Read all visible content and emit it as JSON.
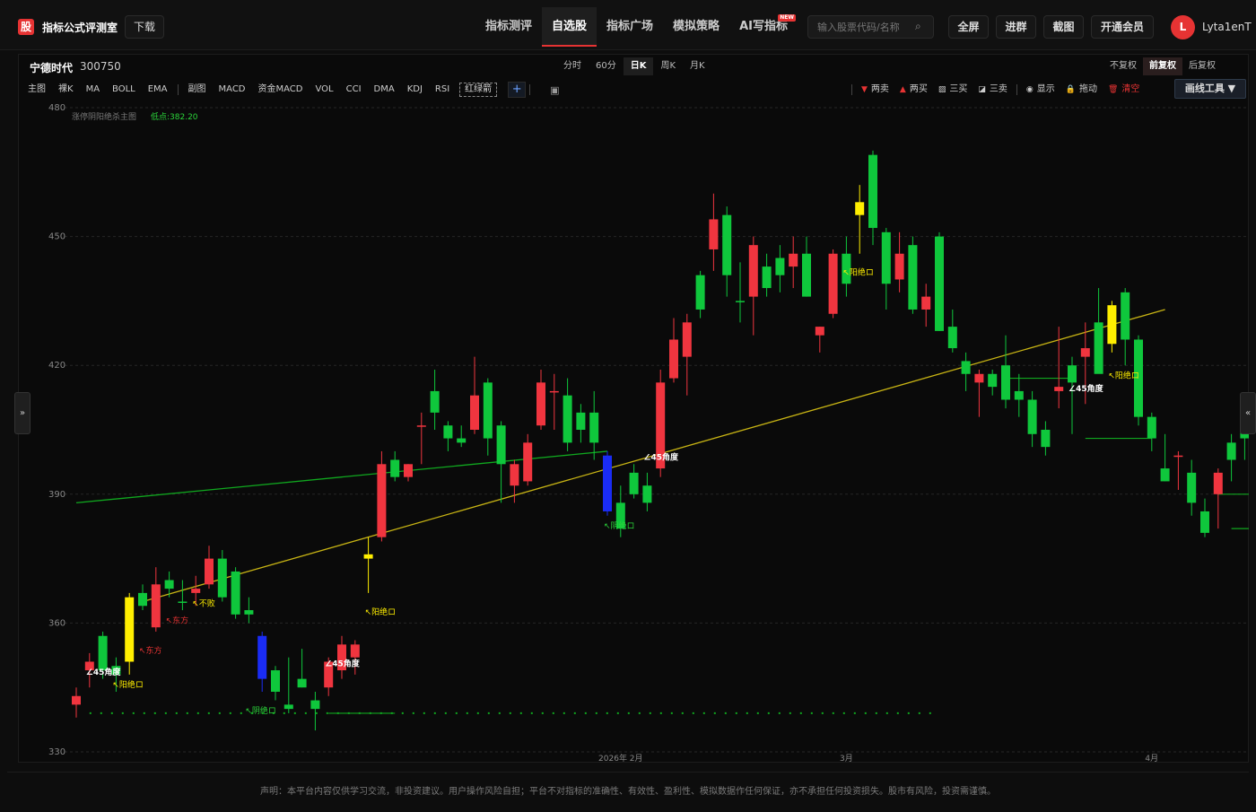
{
  "header": {
    "logo_glyph": "股",
    "logo_text": "指标公式评测室",
    "download_label": "下载",
    "nav": [
      {
        "label": "指标测评",
        "active": false
      },
      {
        "label": "自选股",
        "active": true
      },
      {
        "label": "指标广场",
        "active": false
      },
      {
        "label": "模拟策略",
        "active": false
      },
      {
        "label": "AI写指标",
        "active": false,
        "badge": "NEW"
      }
    ],
    "search_placeholder": "输入股票代码/名称",
    "buttons": [
      "全屏",
      "进群",
      "截图",
      "开通会员"
    ],
    "avatar_letter": "L",
    "username": "Lyta1enT"
  },
  "stock": {
    "name": "宁德时代",
    "code": "300750"
  },
  "periods": [
    {
      "label": "分时",
      "active": false
    },
    {
      "label": "60分",
      "active": false
    },
    {
      "label": "日K",
      "active": true
    },
    {
      "label": "周K",
      "active": false
    },
    {
      "label": "月K",
      "active": false
    }
  ],
  "adjust": [
    {
      "label": "不复权",
      "active": false
    },
    {
      "label": "前复权",
      "active": true
    },
    {
      "label": "后复权",
      "active": false
    }
  ],
  "main_indicators": [
    "主图",
    "裸K",
    "MA",
    "BOLL",
    "EMA"
  ],
  "sub_indicators": [
    "副图",
    "MACD",
    "资金MACD",
    "VOL",
    "CCI",
    "DMA",
    "KDJ",
    "RSI"
  ],
  "boxed_indicator": "红绿箭",
  "plus_label": "+",
  "draw_tools": [
    {
      "icon": "▼",
      "label": "两卖",
      "color": "#e63333"
    },
    {
      "icon": "▲",
      "label": "两买",
      "color": "#e63333"
    },
    {
      "icon": "▨",
      "label": "三买",
      "color": "#ccc"
    },
    {
      "icon": "◪",
      "label": "三卖",
      "color": "#ccc"
    },
    {
      "icon": "◉",
      "label": "显示",
      "color": "#ccc"
    },
    {
      "icon": "🔒",
      "label": "拖动",
      "color": "#ccc"
    },
    {
      "icon": "🗑",
      "label": "清空",
      "color": "#e63333"
    }
  ],
  "draw_tool_button": "画线工具 ▼",
  "side_left": "»",
  "side_right": "«",
  "legend": {
    "name": "涨停阴阳绝杀主图",
    "low": "低点:382.20"
  },
  "footer": "声明：本平台内容仅供学习交流，非投资建议。用户操作风险自担；平台不对指标的准确性、有效性、盈利性、模拟数据作任何保证，亦不承担任何投资损失。股市有风险，投资需谨慎。",
  "chart_data": {
    "type": "candlestick",
    "ylim": [
      330,
      480
    ],
    "y_ticks": [
      330,
      360,
      390,
      420,
      450,
      480
    ],
    "x_labels": [
      {
        "index": 41,
        "label": "2026年 2月"
      },
      {
        "index": 58,
        "label": "3月"
      },
      {
        "index": 81,
        "label": "4月"
      }
    ],
    "colors": {
      "up": "#f0353f",
      "down": "#0fc73c",
      "yellow": "#ffee00",
      "blue": "#1a2cf5"
    },
    "candles": [
      {
        "o": 341,
        "h": 345,
        "l": 338,
        "c": 343,
        "k": "up"
      },
      {
        "o": 349,
        "h": 353,
        "l": 345,
        "c": 351,
        "k": "up"
      },
      {
        "o": 357,
        "h": 358,
        "l": 347,
        "c": 349,
        "k": "down"
      },
      {
        "o": 350,
        "h": 352,
        "l": 344,
        "c": 348,
        "k": "down"
      },
      {
        "o": 351,
        "h": 367,
        "l": 348,
        "c": 366,
        "k": "yellow"
      },
      {
        "o": 367,
        "h": 369,
        "l": 363,
        "c": 364,
        "k": "down"
      },
      {
        "o": 359,
        "h": 373,
        "l": 358,
        "c": 369,
        "k": "up"
      },
      {
        "o": 370,
        "h": 372,
        "l": 366,
        "c": 368,
        "k": "down"
      },
      {
        "o": 365,
        "h": 370,
        "l": 363,
        "c": 365,
        "k": "down"
      },
      {
        "o": 367,
        "h": 371,
        "l": 364,
        "c": 368,
        "k": "up"
      },
      {
        "o": 369,
        "h": 378,
        "l": 368,
        "c": 375,
        "k": "up"
      },
      {
        "o": 375,
        "h": 377,
        "l": 365,
        "c": 366,
        "k": "down"
      },
      {
        "o": 372,
        "h": 373,
        "l": 361,
        "c": 362,
        "k": "down"
      },
      {
        "o": 363,
        "h": 366,
        "l": 360,
        "c": 362,
        "k": "down"
      },
      {
        "o": 357,
        "h": 358,
        "l": 344,
        "c": 347,
        "k": "blue"
      },
      {
        "o": 349,
        "h": 350,
        "l": 342,
        "c": 344,
        "k": "down"
      },
      {
        "o": 341,
        "h": 352,
        "l": 339,
        "c": 340,
        "k": "down"
      },
      {
        "o": 347,
        "h": 354,
        "l": 345,
        "c": 345,
        "k": "down"
      },
      {
        "o": 342,
        "h": 344,
        "l": 335,
        "c": 340,
        "k": "down"
      },
      {
        "o": 345,
        "h": 352,
        "l": 343,
        "c": 351,
        "k": "up"
      },
      {
        "o": 349,
        "h": 357,
        "l": 347,
        "c": 355,
        "k": "up"
      },
      {
        "o": 355,
        "h": 356,
        "l": 348,
        "c": 352,
        "k": "up"
      },
      {
        "o": 376,
        "h": 380,
        "l": 367,
        "c": 375,
        "k": "yellow"
      },
      {
        "o": 380,
        "h": 400,
        "l": 379,
        "c": 397,
        "k": "up"
      },
      {
        "o": 398,
        "h": 400,
        "l": 393,
        "c": 394,
        "k": "down"
      },
      {
        "o": 394,
        "h": 397,
        "l": 393,
        "c": 397,
        "k": "up"
      },
      {
        "o": 406,
        "h": 409,
        "l": 397,
        "c": 406,
        "k": "up"
      },
      {
        "o": 409,
        "h": 419,
        "l": 405,
        "c": 414,
        "k": "down"
      },
      {
        "o": 406,
        "h": 407,
        "l": 400,
        "c": 403,
        "k": "down"
      },
      {
        "o": 403,
        "h": 406,
        "l": 401,
        "c": 402,
        "k": "down"
      },
      {
        "o": 405,
        "h": 422,
        "l": 404,
        "c": 413,
        "k": "up"
      },
      {
        "o": 416,
        "h": 417,
        "l": 399,
        "c": 403,
        "k": "down"
      },
      {
        "o": 406,
        "h": 407,
        "l": 388,
        "c": 397,
        "k": "down"
      },
      {
        "o": 392,
        "h": 398,
        "l": 388,
        "c": 397,
        "k": "up"
      },
      {
        "o": 393,
        "h": 404,
        "l": 392,
        "c": 402,
        "k": "up"
      },
      {
        "o": 406,
        "h": 419,
        "l": 405,
        "c": 416,
        "k": "up"
      },
      {
        "o": 414,
        "h": 418,
        "l": 405,
        "c": 414,
        "k": "up"
      },
      {
        "o": 413,
        "h": 417,
        "l": 400,
        "c": 402,
        "k": "down"
      },
      {
        "o": 409,
        "h": 411,
        "l": 402,
        "c": 405,
        "k": "down"
      },
      {
        "o": 409,
        "h": 414,
        "l": 398,
        "c": 402,
        "k": "down"
      },
      {
        "o": 399,
        "h": 400,
        "l": 385,
        "c": 386,
        "k": "blue"
      },
      {
        "o": 388,
        "h": 392,
        "l": 380,
        "c": 382,
        "k": "down"
      },
      {
        "o": 395,
        "h": 397,
        "l": 389,
        "c": 390,
        "k": "down"
      },
      {
        "o": 392,
        "h": 395,
        "l": 386,
        "c": 388,
        "k": "down"
      },
      {
        "o": 396,
        "h": 419,
        "l": 394,
        "c": 416,
        "k": "up"
      },
      {
        "o": 417,
        "h": 431,
        "l": 416,
        "c": 426,
        "k": "up"
      },
      {
        "o": 422,
        "h": 432,
        "l": 413,
        "c": 430,
        "k": "up"
      },
      {
        "o": 441,
        "h": 442,
        "l": 431,
        "c": 433,
        "k": "down"
      },
      {
        "o": 447,
        "h": 460,
        "l": 442,
        "c": 454,
        "k": "up"
      },
      {
        "o": 455,
        "h": 457,
        "l": 436,
        "c": 441,
        "k": "down"
      },
      {
        "o": 435,
        "h": 444,
        "l": 430,
        "c": 435,
        "k": "down"
      },
      {
        "o": 436,
        "h": 450,
        "l": 427,
        "c": 448,
        "k": "up"
      },
      {
        "o": 443,
        "h": 446,
        "l": 436,
        "c": 438,
        "k": "down"
      },
      {
        "o": 445,
        "h": 448,
        "l": 437,
        "c": 441,
        "k": "down"
      },
      {
        "o": 443,
        "h": 450,
        "l": 438,
        "c": 446,
        "k": "up"
      },
      {
        "o": 446,
        "h": 450,
        "l": 436,
        "c": 436,
        "k": "down"
      },
      {
        "o": 427,
        "h": 429,
        "l": 423,
        "c": 429,
        "k": "up"
      },
      {
        "o": 432,
        "h": 447,
        "l": 431,
        "c": 446,
        "k": "up"
      },
      {
        "o": 446,
        "h": 450,
        "l": 436,
        "c": 439,
        "k": "down"
      },
      {
        "o": 455,
        "h": 462,
        "l": 446,
        "c": 458,
        "k": "yellow"
      },
      {
        "o": 469,
        "h": 470,
        "l": 448,
        "c": 452,
        "k": "down"
      },
      {
        "o": 451,
        "h": 452,
        "l": 433,
        "c": 439,
        "k": "down"
      },
      {
        "o": 440,
        "h": 451,
        "l": 437,
        "c": 446,
        "k": "up"
      },
      {
        "o": 448,
        "h": 450,
        "l": 432,
        "c": 433,
        "k": "down"
      },
      {
        "o": 433,
        "h": 439,
        "l": 429,
        "c": 436,
        "k": "up"
      },
      {
        "o": 450,
        "h": 451,
        "l": 428,
        "c": 428,
        "k": "down"
      },
      {
        "o": 429,
        "h": 433,
        "l": 423,
        "c": 424,
        "k": "down"
      },
      {
        "o": 421,
        "h": 423,
        "l": 414,
        "c": 418,
        "k": "down"
      },
      {
        "o": 416,
        "h": 419,
        "l": 408,
        "c": 418,
        "k": "up"
      },
      {
        "o": 418,
        "h": 419,
        "l": 413,
        "c": 415,
        "k": "down"
      },
      {
        "o": 420,
        "h": 427,
        "l": 410,
        "c": 412,
        "k": "down"
      },
      {
        "o": 414,
        "h": 418,
        "l": 408,
        "c": 412,
        "k": "down"
      },
      {
        "o": 412,
        "h": 414,
        "l": 401,
        "c": 404,
        "k": "down"
      },
      {
        "o": 405,
        "h": 407,
        "l": 399,
        "c": 401,
        "k": "down"
      },
      {
        "o": 414,
        "h": 429,
        "l": 410,
        "c": 415,
        "k": "up"
      },
      {
        "o": 420,
        "h": 422,
        "l": 404,
        "c": 416,
        "k": "down"
      },
      {
        "o": 422,
        "h": 430,
        "l": 411,
        "c": 424,
        "k": "up"
      },
      {
        "o": 430,
        "h": 438,
        "l": 420,
        "c": 418,
        "k": "down"
      },
      {
        "o": 425,
        "h": 435,
        "l": 423,
        "c": 434,
        "k": "yellow"
      },
      {
        "o": 437,
        "h": 438,
        "l": 420,
        "c": 426,
        "k": "down"
      },
      {
        "o": 426,
        "h": 427,
        "l": 406,
        "c": 408,
        "k": "down"
      },
      {
        "o": 408,
        "h": 409,
        "l": 400,
        "c": 403,
        "k": "down"
      },
      {
        "o": 396,
        "h": 404,
        "l": 393,
        "c": 393,
        "k": "down"
      },
      {
        "o": 399,
        "h": 400,
        "l": 391,
        "c": 399,
        "k": "up"
      },
      {
        "o": 395,
        "h": 398,
        "l": 385,
        "c": 388,
        "k": "down"
      },
      {
        "o": 386,
        "h": 389,
        "l": 380,
        "c": 381,
        "k": "down"
      },
      {
        "o": 390,
        "h": 396,
        "l": 382,
        "c": 395,
        "k": "up"
      },
      {
        "o": 402,
        "h": 404,
        "l": 393,
        "c": 398,
        "k": "down"
      },
      {
        "o": 408,
        "h": 409,
        "l": 398,
        "c": 403,
        "k": "down"
      },
      {
        "o": 399,
        "h": 404,
        "l": 396,
        "c": 400,
        "k": "down"
      }
    ],
    "trendlines": [
      {
        "from": [
          0,
          388
        ],
        "to": [
          40,
          400
        ],
        "color": "#10a81f"
      },
      {
        "from": [
          5,
          365
        ],
        "to": [
          82,
          433
        ],
        "color": "#c8b414"
      }
    ],
    "support_lines": [
      {
        "from": 1,
        "to": 65,
        "y": 339,
        "color": "#10a81f",
        "dashed": true
      },
      {
        "from": 19,
        "to": 24,
        "y": 339,
        "color": "#10a81f",
        "dashed": false
      },
      {
        "from": 70,
        "to": 75,
        "y": 417,
        "color": "#10a81f",
        "dashed": false
      },
      {
        "from": 76,
        "to": 81,
        "y": 403,
        "color": "#10a81f",
        "dashed": false
      },
      {
        "from": 86,
        "to": 89,
        "y": 390,
        "color": "#10a81f",
        "dashed": false
      },
      {
        "from": 87,
        "to": 90,
        "y": 382,
        "color": "#10a81f",
        "dashed": false
      }
    ],
    "annotations": [
      {
        "i": 1,
        "y": 348,
        "text": "∠45角度",
        "color": "#ffffff",
        "bold": true
      },
      {
        "i": 3,
        "y": 345,
        "text": "↖阳绝ロ",
        "color": "#ffee00"
      },
      {
        "i": 5,
        "y": 353,
        "text": "↖东方",
        "color": "#e63333"
      },
      {
        "i": 7,
        "y": 360,
        "text": "↖东方",
        "color": "#e63333"
      },
      {
        "i": 9,
        "y": 364,
        "text": "↖不败",
        "color": "#ffee00"
      },
      {
        "i": 13,
        "y": 339,
        "text": "↖阴绝ロ",
        "color": "#2bd43a"
      },
      {
        "i": 19,
        "y": 350,
        "text": "∠45角度",
        "color": "#ffffff",
        "bold": true
      },
      {
        "i": 22,
        "y": 362,
        "text": "↖阳绝ロ",
        "color": "#ffee00"
      },
      {
        "i": 40,
        "y": 382,
        "text": "↖阴绝ロ",
        "color": "#2bd43a"
      },
      {
        "i": 43,
        "y": 398,
        "text": "∠45角度",
        "color": "#ffffff",
        "bold": true
      },
      {
        "i": 58,
        "y": 441,
        "text": "↖阳绝ロ",
        "color": "#ffee00"
      },
      {
        "i": 75,
        "y": 414,
        "text": "∠45角度",
        "color": "#ffffff",
        "bold": true
      },
      {
        "i": 78,
        "y": 417,
        "text": "↖阳绝ロ",
        "color": "#ffee00"
      }
    ]
  }
}
